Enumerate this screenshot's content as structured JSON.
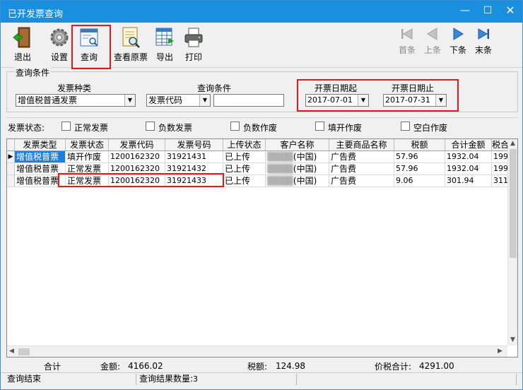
{
  "window": {
    "title": "已开发票查询"
  },
  "toolbar": {
    "exit": "退出",
    "settings": "设置",
    "query": "查询",
    "view_original": "查看原票",
    "export": "导出",
    "print": "打印",
    "first": "首条",
    "prev": "上条",
    "next": "下条",
    "last": "末条"
  },
  "query": {
    "section_label": "查询条件",
    "invoice_type_label": "发票种类",
    "invoice_type_value": "增值税普通发票",
    "condition_label": "查询条件",
    "condition_field": "发票代码",
    "condition_value": "",
    "date_from_label": "开票日期起",
    "date_from": "2017-07-01",
    "date_to_label": "开票日期止",
    "date_to": "2017-07-31"
  },
  "status_filter": {
    "label": "发票状态:",
    "options": [
      "正常发票",
      "负数发票",
      "负数作废",
      "填开作废",
      "空白作废"
    ]
  },
  "table": {
    "columns": [
      "发票类型",
      "发票状态",
      "发票代码",
      "发票号码",
      "上传状态",
      "客户名称",
      "主要商品名称",
      "税额",
      "合计金额",
      "税合"
    ],
    "rows": [
      [
        "增值税普票",
        "填开作废",
        "1200162320",
        "31921431",
        "已上传",
        "(中国)",
        "广告费",
        "57.96",
        "1932.04",
        "199"
      ],
      [
        "增值税普票",
        "正常发票",
        "1200162320",
        "31921432",
        "已上传",
        "(中国)",
        "广告费",
        "57.96",
        "1932.04",
        "199"
      ],
      [
        "增值税普票",
        "正常发票",
        "1200162320",
        "31921433",
        "已上传",
        "(中国)",
        "广告费",
        "9.06",
        "301.94",
        "311"
      ]
    ]
  },
  "totals": {
    "label": "合计",
    "amount_label": "金额:",
    "amount": "4166.02",
    "tax_label": "税额:",
    "tax": "124.98",
    "total_label": "价税合计:",
    "total": "4291.00"
  },
  "statusbar": {
    "status": "查询结束",
    "count_label": "查询结果数量:",
    "count": "3"
  },
  "colors": {
    "titlebar": "#1a8fe0",
    "selection": "#1e7fe0",
    "highlight": "#e0191e"
  }
}
